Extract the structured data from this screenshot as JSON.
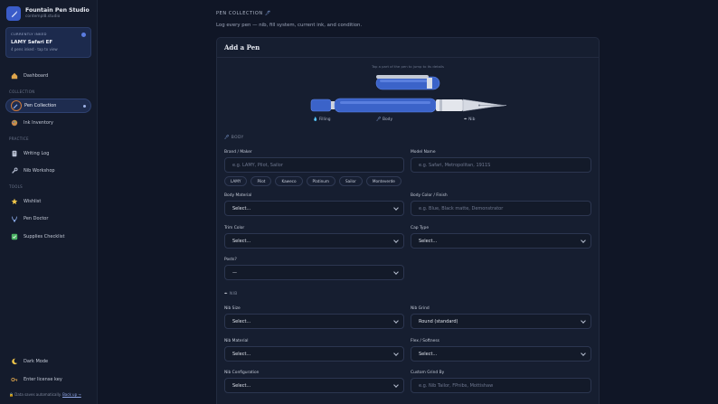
{
  "app": {
    "title": "Fountain Pen Studio",
    "subtitle": "contempl8.studio"
  },
  "inked": {
    "label": "CURRENTLY INKED",
    "pen": "LAMY Safari EF",
    "info": "4 pens inked · tap to view"
  },
  "nav": {
    "dashboard": "Dashboard",
    "collection_section": "COLLECTION",
    "pen_collection": "Pen Collection",
    "ink_inventory": "Ink Inventory",
    "practice_section": "PRACTICE",
    "writing_log": "Writing Log",
    "nib_workshop": "Nib Workshop",
    "tools_section": "TOOLS",
    "wishlist": "Wishlist",
    "pen_doctor": "Pen Doctor",
    "supplies_checklist": "Supplies Checklist",
    "dark_mode": "Dark Mode",
    "license": "Enter license key"
  },
  "footer": {
    "note": "Data saves automatically.",
    "link": "Back up →"
  },
  "page": {
    "kicker": "PEN COLLECTION",
    "desc": "Log every pen — nib, fill system, current ink, and condition."
  },
  "form": {
    "title": "Add a Pen",
    "hint": "Tap a part of the pen to jump to its details",
    "parts": {
      "filling": "Filling",
      "body": "Body",
      "nib": "Nib"
    },
    "body_section": "BODY",
    "nib_section": "NIB",
    "brand": {
      "label": "Brand / Maker",
      "placeholder": "e.g. LAMY, Pilot, Sailor"
    },
    "model": {
      "label": "Model Name",
      "placeholder": "e.g. Safari, Metropolitan, 1911S"
    },
    "chips": [
      "LAMY",
      "Pilot",
      "Kaweco",
      "Platinum",
      "Sailor",
      "Monteverde"
    ],
    "body_material": {
      "label": "Body Material",
      "value": "Select..."
    },
    "body_color": {
      "label": "Body Color / Finish",
      "placeholder": "e.g. Blue, Black matte, Demonstrator"
    },
    "trim_color": {
      "label": "Trim Color",
      "value": "Select..."
    },
    "cap_type": {
      "label": "Cap Type",
      "value": "Select..."
    },
    "posts": {
      "label": "Posts?",
      "value": "—"
    },
    "nib_size": {
      "label": "Nib Size",
      "value": "Select..."
    },
    "nib_grind": {
      "label": "Nib Grind",
      "value": "Round (standard)"
    },
    "nib_material": {
      "label": "Nib Material",
      "value": "Select..."
    },
    "flex": {
      "label": "Flex / Softness",
      "value": "Select..."
    },
    "nib_config": {
      "label": "Nib Configuration",
      "value": "Select..."
    },
    "custom_grind": {
      "label": "Custom Grind By",
      "placeholder": "e.g. Nib Tailor, FPnibs, Mottishaw"
    }
  },
  "colors": {
    "accent": "#3a5cc9",
    "pen_blue": "#3b63c9",
    "background": "#101626"
  }
}
